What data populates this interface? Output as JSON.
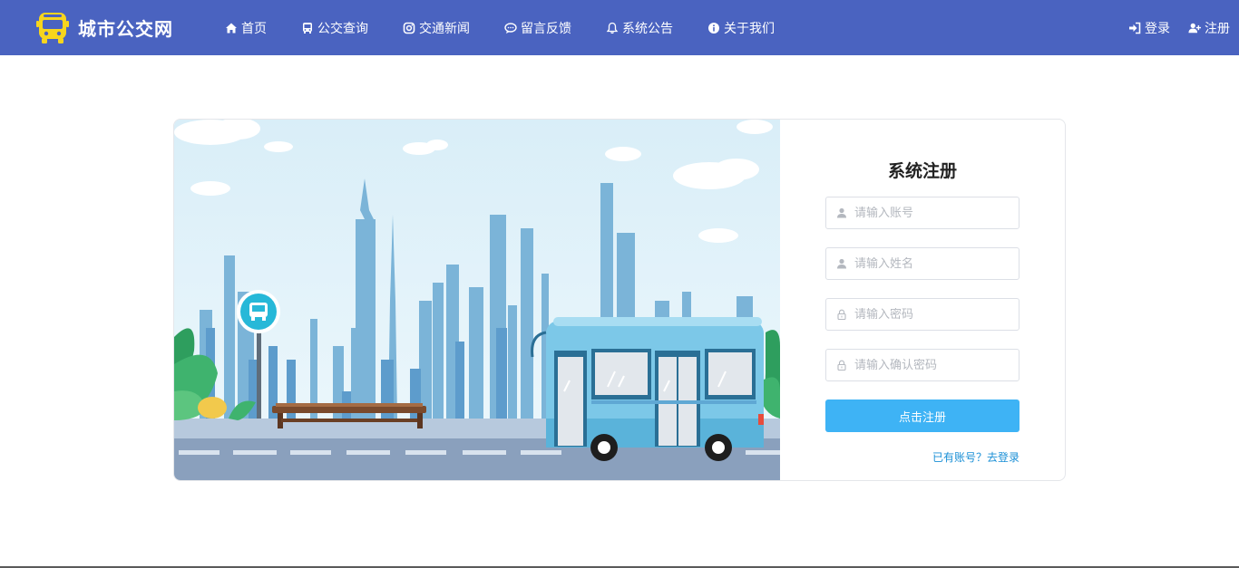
{
  "brand": {
    "name": "城市公交网",
    "icon": "bus-logo-icon"
  },
  "nav": {
    "items": [
      {
        "label": "首页",
        "icon": "home-icon"
      },
      {
        "label": "公交查询",
        "icon": "bus-icon"
      },
      {
        "label": "交通新闻",
        "icon": "instagram-icon"
      },
      {
        "label": "留言反馈",
        "icon": "chat-icon"
      },
      {
        "label": "系统公告",
        "icon": "bell-icon"
      },
      {
        "label": "关于我们",
        "icon": "info-icon"
      }
    ],
    "right": [
      {
        "label": "登录",
        "icon": "sign-in-icon"
      },
      {
        "label": "注册",
        "icon": "user-plus-icon"
      }
    ]
  },
  "form": {
    "title": "系统注册",
    "fields": [
      {
        "placeholder": "请输入账号",
        "icon": "user-icon",
        "value": ""
      },
      {
        "placeholder": "请输入姓名",
        "icon": "user-icon",
        "value": ""
      },
      {
        "placeholder": "请输入密码",
        "icon": "lock-icon",
        "value": ""
      },
      {
        "placeholder": "请输入确认密码",
        "icon": "lock-icon",
        "value": ""
      }
    ],
    "submit_label": "点击注册",
    "login_link": "已有账号？去登录"
  },
  "colors": {
    "navbar": "#4a63c0",
    "button": "#3eb3f5",
    "link": "#1a8fd6",
    "logo": "#f7d51d"
  }
}
